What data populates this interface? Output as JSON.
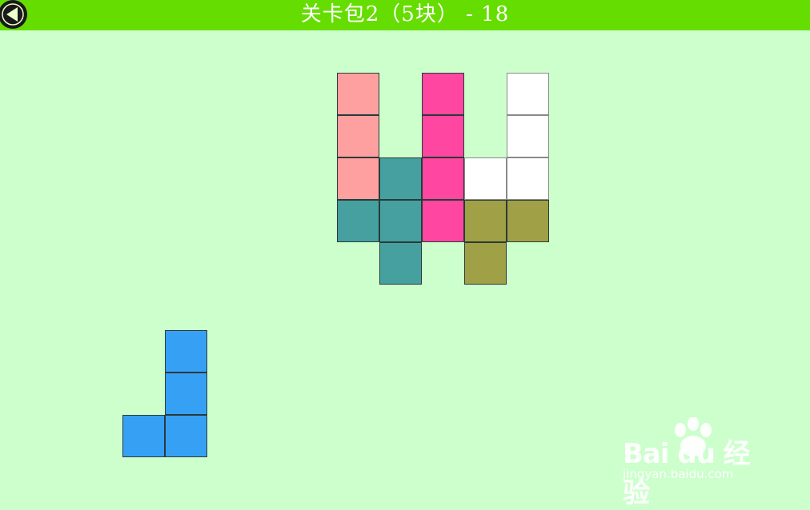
{
  "header": {
    "title": "关卡包2（5块） - 18",
    "back_icon": "back-arrow-icon",
    "bar_color": "#66dd00"
  },
  "puzzle": {
    "cell_size": 53,
    "pieces": [
      {
        "name": "pink-light",
        "color": "#ffa0a0",
        "cells": [
          [
            0,
            0
          ],
          [
            0,
            1
          ],
          [
            0,
            2
          ]
        ]
      },
      {
        "name": "magenta",
        "color": "#ff46a0",
        "cells": [
          [
            2,
            0
          ],
          [
            2,
            1
          ],
          [
            2,
            2
          ],
          [
            2,
            3
          ]
        ]
      },
      {
        "name": "white",
        "color": "#ffffff",
        "cells": [
          [
            4,
            0
          ],
          [
            4,
            1
          ],
          [
            3,
            2
          ],
          [
            4,
            2
          ]
        ]
      },
      {
        "name": "teal",
        "color": "#46a0a0",
        "cells": [
          [
            1,
            2
          ],
          [
            0,
            3
          ],
          [
            1,
            3
          ],
          [
            1,
            4
          ]
        ]
      },
      {
        "name": "olive",
        "color": "#a0a046",
        "cells": [
          [
            3,
            3
          ],
          [
            4,
            3
          ],
          [
            3,
            4
          ]
        ]
      }
    ]
  },
  "tray": {
    "pieces": [
      {
        "name": "blue-j",
        "color": "#36a0f5",
        "cells": [
          [
            1,
            0
          ],
          [
            1,
            1
          ],
          [
            0,
            2
          ],
          [
            1,
            2
          ]
        ]
      }
    ]
  },
  "watermark": {
    "brand": "Bai du 经验",
    "url": "jingyan.baidu.com"
  }
}
